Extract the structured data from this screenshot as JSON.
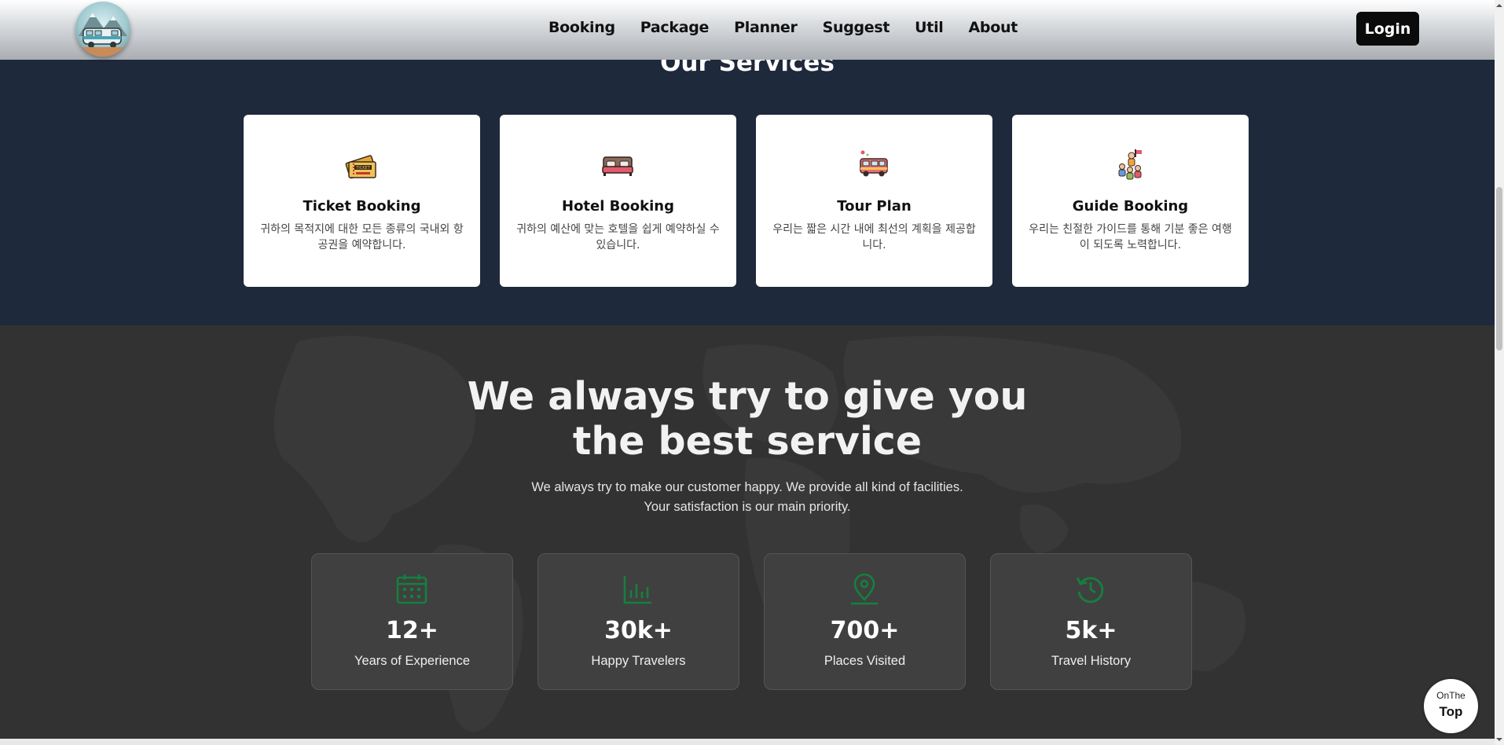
{
  "nav": {
    "items": [
      {
        "label": "Booking"
      },
      {
        "label": "Package"
      },
      {
        "label": "Planner"
      },
      {
        "label": "Suggest"
      },
      {
        "label": "Util"
      },
      {
        "label": "About"
      }
    ],
    "login_label": "Login"
  },
  "services": {
    "title": "Our Services",
    "cards": [
      {
        "icon": "ticket-icon",
        "title": "Ticket Booking",
        "desc": "귀하의 목적지에 대한 모든 종류의 국내외 항공권을 예약합니다."
      },
      {
        "icon": "bed-icon",
        "title": "Hotel Booking",
        "desc": "귀하의 예산에 맞는 호텔을 쉽게 예약하실 수 있습니다."
      },
      {
        "icon": "camper-van-icon",
        "title": "Tour Plan",
        "desc": "우리는 짧은 시간 내에 최선의 계획을 제공합니다."
      },
      {
        "icon": "tour-guide-icon",
        "title": "Guide Booking",
        "desc": "우리는 친절한 가이드를 통해 기분 좋은 여행이 되도록 노력합니다."
      }
    ]
  },
  "stats": {
    "title_line1": "We always try to give you",
    "title_line2": "the best service",
    "subtitle_line1": "We always try to make our customer happy. We provide all kind of facilities.",
    "subtitle_line2": "Your satisfaction is our main priority.",
    "accent_color": "#15803d",
    "cards": [
      {
        "icon": "calendar-icon",
        "value": "12+",
        "label": "Years of Experience"
      },
      {
        "icon": "bar-chart-icon",
        "value": "30k+",
        "label": "Happy Travelers"
      },
      {
        "icon": "map-pin-icon",
        "value": "700+",
        "label": "Places Visited"
      },
      {
        "icon": "history-icon",
        "value": "5k+",
        "label": "Travel History"
      }
    ]
  },
  "top_button": {
    "small_label": "OnThe",
    "large_label": "Top"
  }
}
